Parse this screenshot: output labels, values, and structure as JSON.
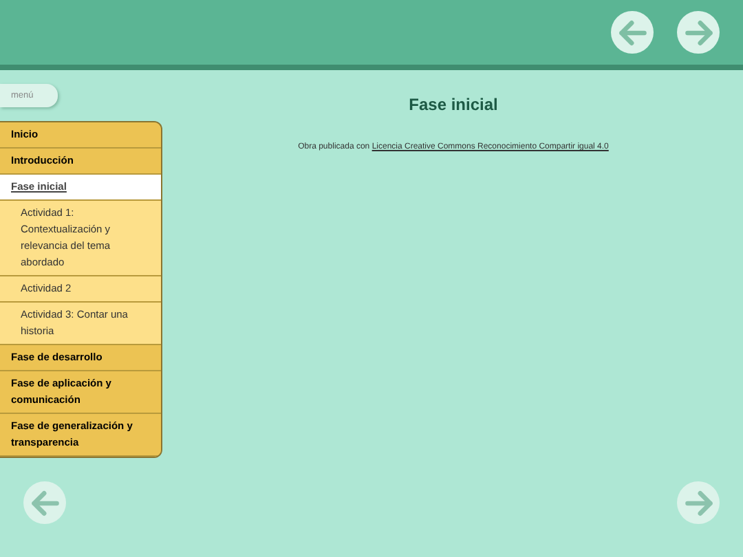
{
  "header": {
    "nav": [
      {
        "kind": "prev"
      },
      {
        "kind": "next"
      }
    ]
  },
  "menu_button": "menú",
  "menu": [
    {
      "label": "Inicio",
      "selected": false
    },
    {
      "label": "Introducción",
      "selected": false
    },
    {
      "label": "Fase inicial",
      "selected": true,
      "children": [
        {
          "label": "Actividad 1: Contextualización y relevancia del tema abordado",
          "selected": false
        },
        {
          "label": "Actividad 2",
          "selected": false
        },
        {
          "label": "Actividad 3: Contar una historia",
          "selected": false
        }
      ]
    },
    {
      "label": "Fase de desarrollo",
      "selected": false
    },
    {
      "label": "Fase de aplicación y comunicación",
      "selected": false
    },
    {
      "label": "Fase de generalización y transparencia",
      "selected": false
    }
  ],
  "content": {
    "title": "Fase inicial",
    "credit": "Obra publicada con",
    "license_link": "Licencia Creative Commons Reconocimiento Compartir igual 4.0"
  },
  "footer_nav": [
    {
      "kind": "prev"
    },
    {
      "kind": "next"
    }
  ]
}
